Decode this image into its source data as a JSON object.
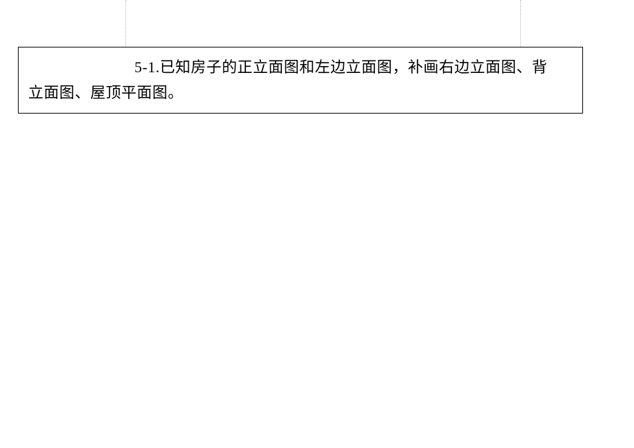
{
  "problem": {
    "number_label": "5-1.",
    "text_part1": "已知房子的正立面图和左边立面图，补画右边立面图、背",
    "text_part2": "立面图、屋顶平面图。"
  }
}
